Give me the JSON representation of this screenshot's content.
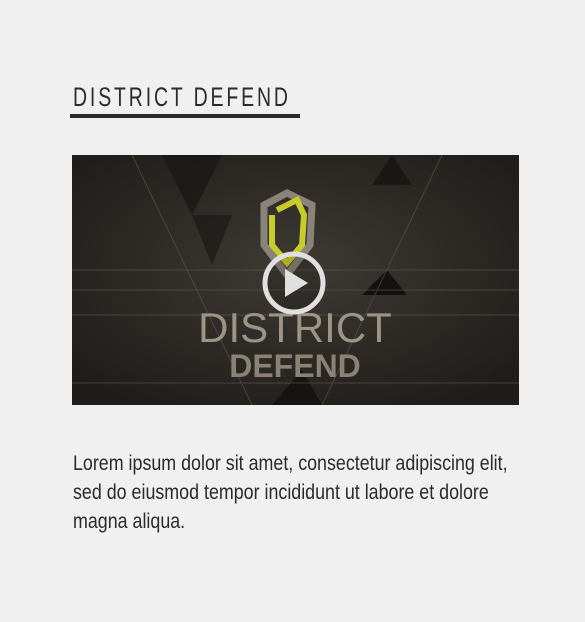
{
  "heading": "DISTRICT DEFEND",
  "video": {
    "thumbnail_title_line1": "DISTRICT",
    "thumbnail_title_line2": "DEFEND",
    "icon": "play-icon",
    "colors": {
      "background": "#2c2925",
      "accent": "#c8cc2a",
      "text": "#9c9484"
    }
  },
  "body_text": "Lorem ipsum dolor sit amet, consectetur adipiscing elit, sed do eiusmod tempor incididunt ut labore et dolore magna aliqua."
}
